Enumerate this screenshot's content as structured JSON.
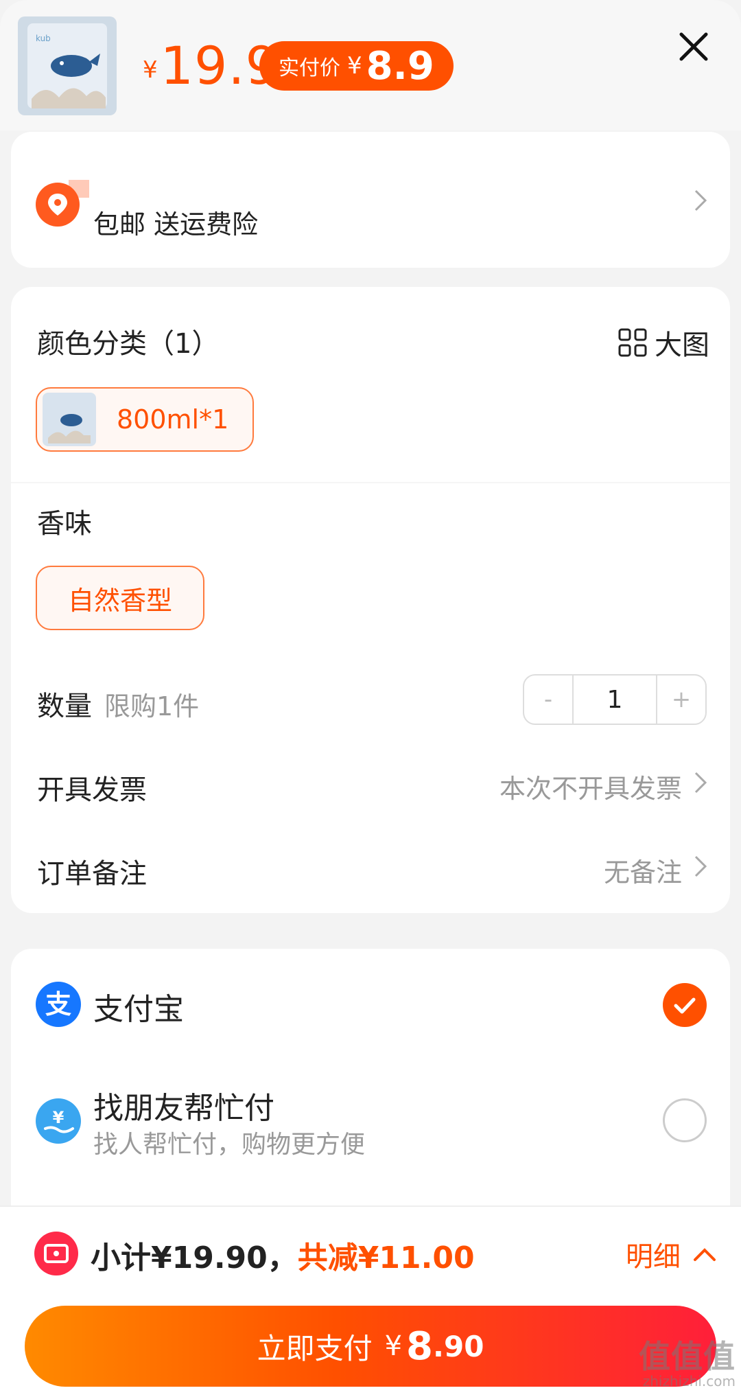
{
  "header": {
    "price_symbol": "¥",
    "price": "19.9",
    "pay_label": "实付价",
    "pay_symbol": "¥",
    "pay_value": "8.9",
    "close_icon": "close-icon"
  },
  "address": {
    "icon": "location-pin-icon",
    "shipping_text": "包邮 送运费险"
  },
  "spec": {
    "color_label": "颜色分类（1）",
    "big_image_label": "大图",
    "color_option": "800ml*1",
    "scent_label": "香味",
    "scent_option": "自然香型",
    "quantity_label": "数量",
    "quantity_limit": "限购1件",
    "quantity_minus": "-",
    "quantity_value": "1",
    "quantity_plus": "+",
    "invoice_label": "开具发票",
    "invoice_value": "本次不开具发票",
    "remark_label": "订单备注",
    "remark_value": "无备注"
  },
  "payment": {
    "alipay_name": "支付宝",
    "friend_pay_name": "找朋友帮忙付",
    "friend_pay_desc": "找人帮忙付，购物更方便"
  },
  "bottom": {
    "subtotal": "小计¥19.90，",
    "discount": "共减¥11.00",
    "detail_label": "明细",
    "pay_now_label": "立即支付",
    "pay_now_symbol": "¥",
    "pay_now_value": "8",
    "pay_now_cents": ".90"
  },
  "watermark": {
    "main": "值值值",
    "sub": "zhizhizhi.com"
  },
  "colors": {
    "accent": "#ff5000",
    "alipay_blue": "#1677ff",
    "coupon_red": "#ff2a49"
  }
}
